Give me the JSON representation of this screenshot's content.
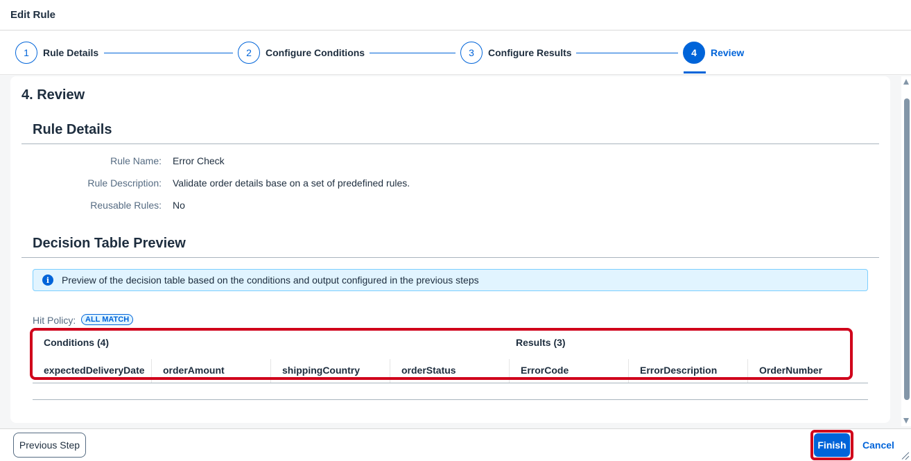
{
  "dialog": {
    "title": "Edit Rule"
  },
  "wizard": {
    "steps": [
      {
        "number": "1",
        "label": "Rule Details"
      },
      {
        "number": "2",
        "label": "Configure Conditions"
      },
      {
        "number": "3",
        "label": "Configure Results"
      },
      {
        "number": "4",
        "label": "Review"
      }
    ]
  },
  "review": {
    "heading": "4. Review",
    "rule_details": {
      "title": "Rule Details",
      "fields": [
        {
          "label": "Rule Name:",
          "value": "Error Check"
        },
        {
          "label": "Rule Description:",
          "value": "Validate order details base on a set of predefined rules."
        },
        {
          "label": "Reusable Rules:",
          "value": "No"
        }
      ]
    },
    "decision_table": {
      "title": "Decision Table Preview",
      "info_message": "Preview of the decision table based on the conditions and output configured in the previous steps",
      "hit_policy_label": "Hit Policy:",
      "hit_policy_value": "ALL MATCH",
      "conditions_header": "Conditions (4)",
      "results_header": "Results (3)",
      "columns": [
        "expectedDeliveryDate",
        "orderAmount",
        "shippingCountry",
        "orderStatus",
        "ErrorCode",
        "ErrorDescription",
        "OrderNumber"
      ]
    }
  },
  "footer": {
    "previous_label": "Previous Step",
    "finish_label": "Finish",
    "cancel_label": "Cancel"
  },
  "colors": {
    "accent": "#0064d9",
    "highlight": "#d0021b",
    "info_background": "#e1f4ff"
  }
}
